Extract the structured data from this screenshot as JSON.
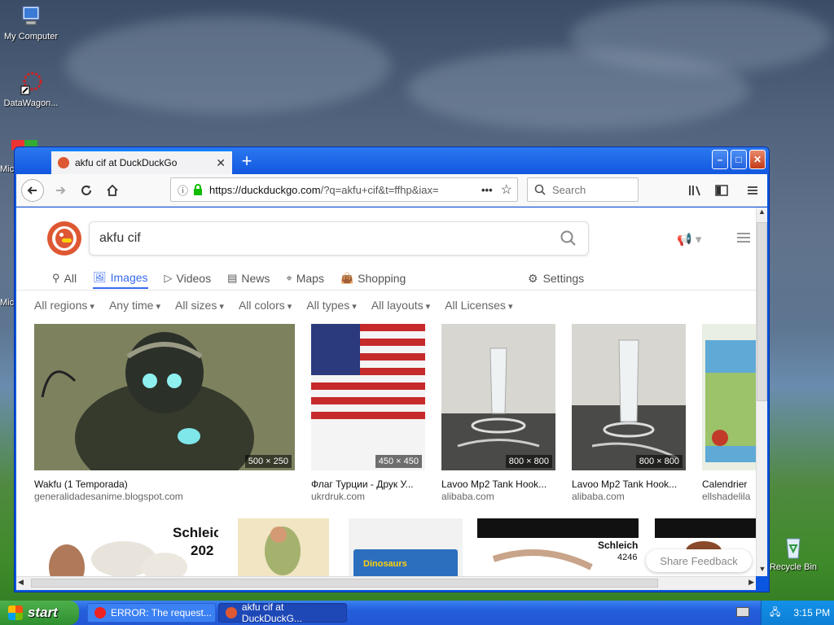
{
  "desktop": {
    "icons": [
      {
        "label": "My Computer"
      },
      {
        "label": "DataWagon..."
      },
      {
        "label": "Mic"
      },
      {
        "label": "Mic"
      },
      {
        "label": "Recycle Bin"
      }
    ]
  },
  "browser": {
    "tab_title": "akfu cif at DuckDuckGo",
    "url_main": "https://duckduckgo.com",
    "url_rest": "/?q=akfu+cif&t=ffhp&iax=",
    "search_placeholder": "Search"
  },
  "ddg": {
    "query": "akfu cif",
    "tabs": [
      {
        "label": "All",
        "icon": "search-icon"
      },
      {
        "label": "Images",
        "icon": "image-icon",
        "active": true
      },
      {
        "label": "Videos",
        "icon": "play-icon"
      },
      {
        "label": "News",
        "icon": "news-icon"
      },
      {
        "label": "Maps",
        "icon": "map-pin-icon"
      },
      {
        "label": "Shopping",
        "icon": "shopping-bag-icon"
      }
    ],
    "settings_label": "Settings",
    "filters": [
      "All regions",
      "Any time",
      "All sizes",
      "All colors",
      "All types",
      "All layouts",
      "All Licenses"
    ],
    "results": [
      {
        "title": "Wakfu (1 Temporada)",
        "source": "generalidadesanime.blogspot.com",
        "dims": "500 × 250"
      },
      {
        "title": "Флаг Турции - Друк У...",
        "source": "ukrdruk.com",
        "dims": "450 × 450"
      },
      {
        "title": "Lavoo Mp2 Tank Hook...",
        "source": "alibaba.com",
        "dims": "800 × 800"
      },
      {
        "title": "Lavoo Mp2 Tank Hook...",
        "source": "alibaba.com",
        "dims": "800 × 800"
      },
      {
        "title": "Calendrier",
        "source": "ellshadelila",
        "dims": ""
      }
    ],
    "row2_texts": {
      "schleich1": "Schleic",
      "year": "202",
      "dinosaurs": "Dinosaurs",
      "schleich2": "Schleich",
      "num": "4246"
    },
    "feedback_label": "Share Feedback"
  },
  "taskbar": {
    "start_label": "start",
    "tasks": [
      {
        "label": "ERROR: The request..."
      },
      {
        "label": "akfu cif at DuckDuckG..."
      }
    ],
    "clock": "3:15 PM"
  }
}
